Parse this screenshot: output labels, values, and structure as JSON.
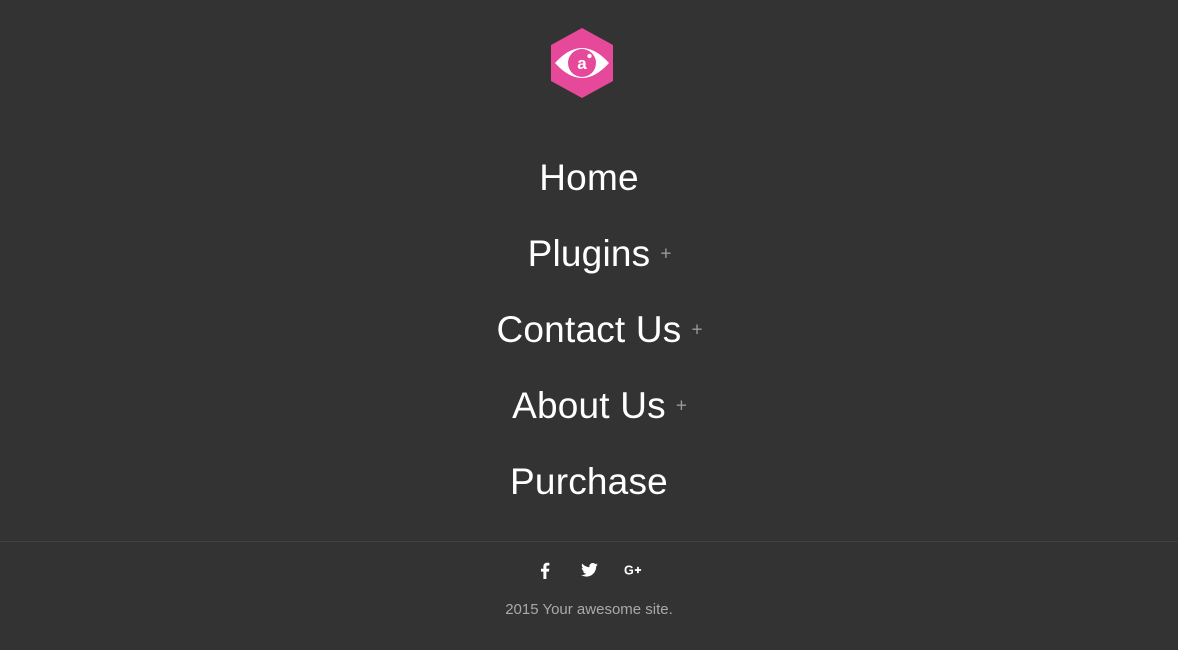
{
  "header": {
    "logo_icon": "eye-hexagon-logo",
    "logo_mark": "a",
    "brand_color": "#e6489a"
  },
  "menu": {
    "items": [
      {
        "label": "Home",
        "has_submenu": false
      },
      {
        "label": "Plugins",
        "has_submenu": true,
        "submenu_toggle": "+"
      },
      {
        "label": "Contact Us",
        "has_submenu": true,
        "submenu_toggle": "+"
      },
      {
        "label": "About Us",
        "has_submenu": true,
        "submenu_toggle": "+"
      },
      {
        "label": "Purchase",
        "has_submenu": false
      }
    ]
  },
  "footer": {
    "social": [
      {
        "icon": "facebook-icon"
      },
      {
        "icon": "twitter-icon"
      },
      {
        "icon": "google-plus-icon"
      }
    ],
    "copyright": "2015 Your awesome site."
  },
  "colors": {
    "background": "#333333",
    "text": "#ffffff",
    "muted_text": "#a9a9a9",
    "divider": "#424242"
  }
}
